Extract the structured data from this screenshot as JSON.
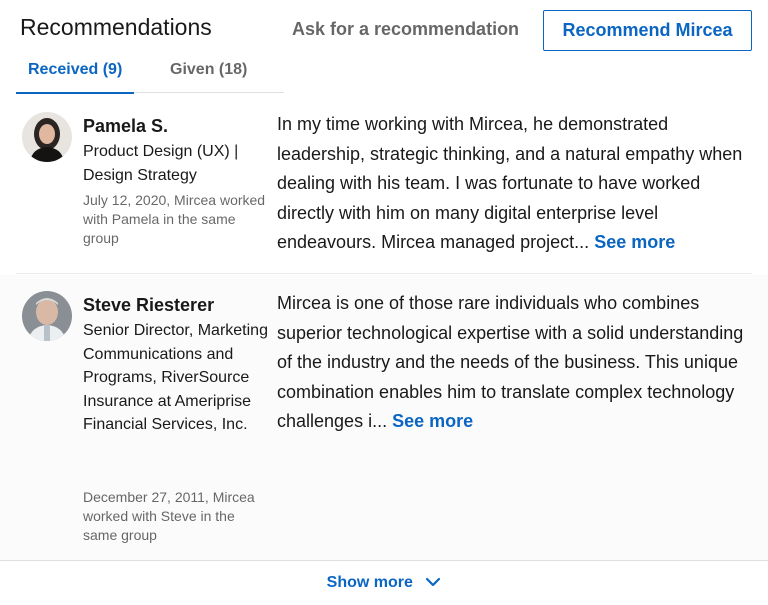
{
  "header": {
    "title": "Recommendations",
    "ask_link": "Ask for a recommendation",
    "recommend_button": "Recommend Mircea"
  },
  "tabs": [
    {
      "label": "Received (9)",
      "active": true
    },
    {
      "label": "Given (18)",
      "active": false
    }
  ],
  "recommendations": [
    {
      "name": "Pamela S.",
      "headline": "Product Design (UX) | Design Strategy",
      "meta": "July 12, 2020, Mircea worked with Pamela in the same group",
      "text": "In my time working with Mircea, he demonstrated leadership, strategic thinking, and a natural empathy when dealing with his team. I was fortunate to have worked directly with him on many digital enterprise level endeavours. Mircea managed project...",
      "see_more": "See more"
    },
    {
      "name": "Steve Riesterer",
      "headline": "Senior Director, Marketing Communications and Programs, RiverSource Insurance at Ameriprise Financial Services, Inc.",
      "meta": "December 27, 2011, Mircea worked with Steve in the same group",
      "text": "Mircea is one of those rare individuals who combines superior technological expertise with a solid understanding of the industry and the needs of the business. This unique combination enables him to translate complex technology challenges i...",
      "see_more": "See more"
    }
  ],
  "footer": {
    "show_more": "Show more"
  },
  "colors": {
    "accent": "#0a66c2",
    "text_primary": "#1d1d1d",
    "text_secondary": "#666666"
  },
  "icons": {
    "show_more_icon": "chevron-down-icon"
  }
}
